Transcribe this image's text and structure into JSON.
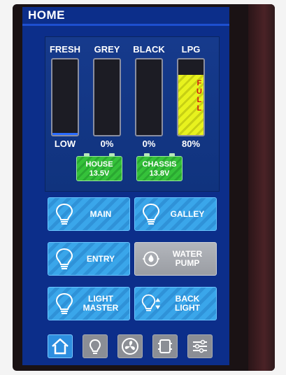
{
  "header": {
    "title": "HOME"
  },
  "tanks": [
    {
      "id": "fresh",
      "label": "FRESH",
      "value": "LOW",
      "fill_fraction": 0.03,
      "overlay_text": ""
    },
    {
      "id": "grey",
      "label": "GREY",
      "value": "0%",
      "fill_fraction": 0.0,
      "overlay_text": ""
    },
    {
      "id": "black",
      "label": "BLACK",
      "value": "0%",
      "fill_fraction": 0.0,
      "overlay_text": ""
    },
    {
      "id": "lpg",
      "label": "LPG",
      "value": "80%",
      "fill_fraction": 0.8,
      "overlay_text": "FULL"
    }
  ],
  "batteries": [
    {
      "label": "HOUSE",
      "voltage": "13.5V"
    },
    {
      "label": "CHASSIS",
      "voltage": "13.8V"
    }
  ],
  "controls": {
    "main": {
      "label": "MAIN",
      "icon": "lightbulb-icon"
    },
    "galley": {
      "label": "GALLEY",
      "icon": "lightbulb-icon"
    },
    "entry": {
      "label": "ENTRY",
      "icon": "lightbulb-icon"
    },
    "water_pump": {
      "label_line1": "WATER",
      "label_line2": "PUMP",
      "icon": "pump-icon"
    },
    "light_master": {
      "label_line1": "LIGHT",
      "label_line2": "MASTER",
      "icon": "lightbulb-icon"
    },
    "back_light": {
      "label_line1": "BACK",
      "label_line2": "LIGHT",
      "icon": "brightness-icon"
    }
  },
  "nav": [
    {
      "icon": "home-icon",
      "active": true
    },
    {
      "icon": "lightbulb-icon",
      "active": false
    },
    {
      "icon": "fan-icon",
      "active": false
    },
    {
      "icon": "generator-icon",
      "active": false
    },
    {
      "icon": "settings-sliders-icon",
      "active": false
    }
  ],
  "colors": {
    "screen_bg": "#0c2e8a",
    "button_blue": "#3aa6ea",
    "button_gray": "#a8abb1",
    "battery_green": "#35c23a",
    "lpg_yellow": "#e8f21e"
  }
}
